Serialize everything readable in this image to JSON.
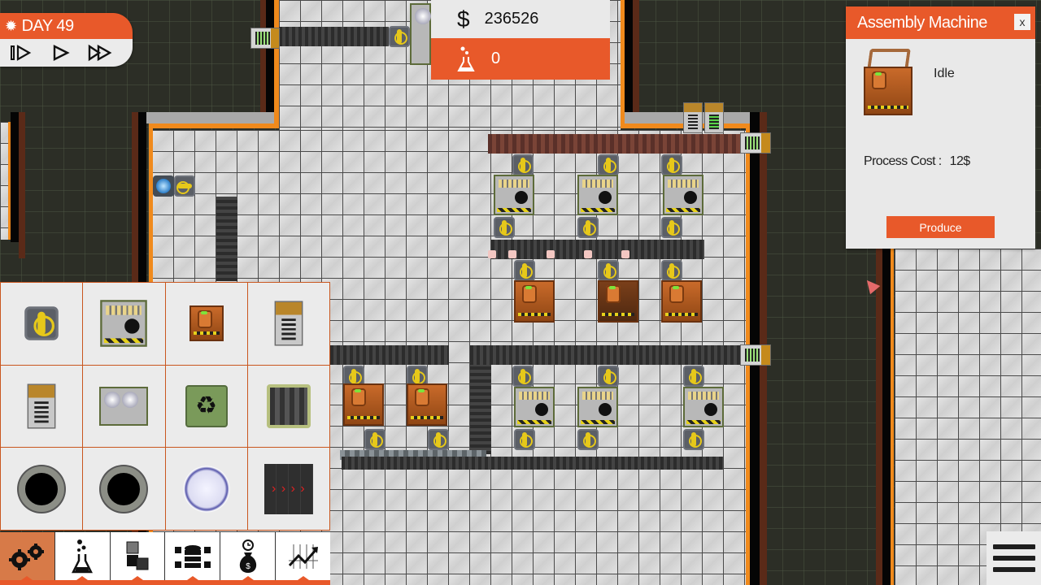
{
  "hud": {
    "day_label": "DAY 49",
    "speed_controls": [
      {
        "name": "step",
        "glyph": "⏵⏸"
      },
      {
        "name": "play",
        "glyph": "▷"
      },
      {
        "name": "fast-forward",
        "glyph": "⏩"
      }
    ],
    "money_symbol": "$",
    "money": "236526",
    "research_points": "0"
  },
  "info_panel": {
    "title": "Assembly Machine",
    "close_label": "x",
    "status": "Idle",
    "process_cost_label": "Process Cost :",
    "process_cost_value": "12$",
    "produce_label": "Produce"
  },
  "build_menu": {
    "items": [
      {
        "name": "robotic-arm",
        "icon": "arm"
      },
      {
        "name": "fabricator",
        "icon": "fab"
      },
      {
        "name": "assembly-machine",
        "icon": "asm"
      },
      {
        "name": "seller",
        "icon": "hopper"
      },
      {
        "name": "importer",
        "icon": "hopper-up"
      },
      {
        "name": "mixer",
        "icon": "sorter"
      },
      {
        "name": "recycler",
        "icon": "♻"
      },
      {
        "name": "shredder",
        "icon": "shredder"
      },
      {
        "name": "portal-in",
        "icon": "portal"
      },
      {
        "name": "portal-out",
        "icon": "portal"
      },
      {
        "name": "generator",
        "icon": "generator"
      },
      {
        "name": "conveyor-belt",
        "icon": "belt"
      }
    ]
  },
  "tabs": [
    {
      "name": "machines",
      "icon": "⚙",
      "active": true
    },
    {
      "name": "research",
      "icon": "⚗",
      "active": false
    },
    {
      "name": "storage",
      "icon": "▦",
      "active": false
    },
    {
      "name": "database",
      "icon": "⛁",
      "active": false
    },
    {
      "name": "finance",
      "icon": "$",
      "active": false
    },
    {
      "name": "statistics",
      "icon": "📈",
      "active": false
    }
  ],
  "colors": {
    "accent": "#e8592a",
    "panel": "#e9e9e9",
    "void": "#2c2e26"
  }
}
